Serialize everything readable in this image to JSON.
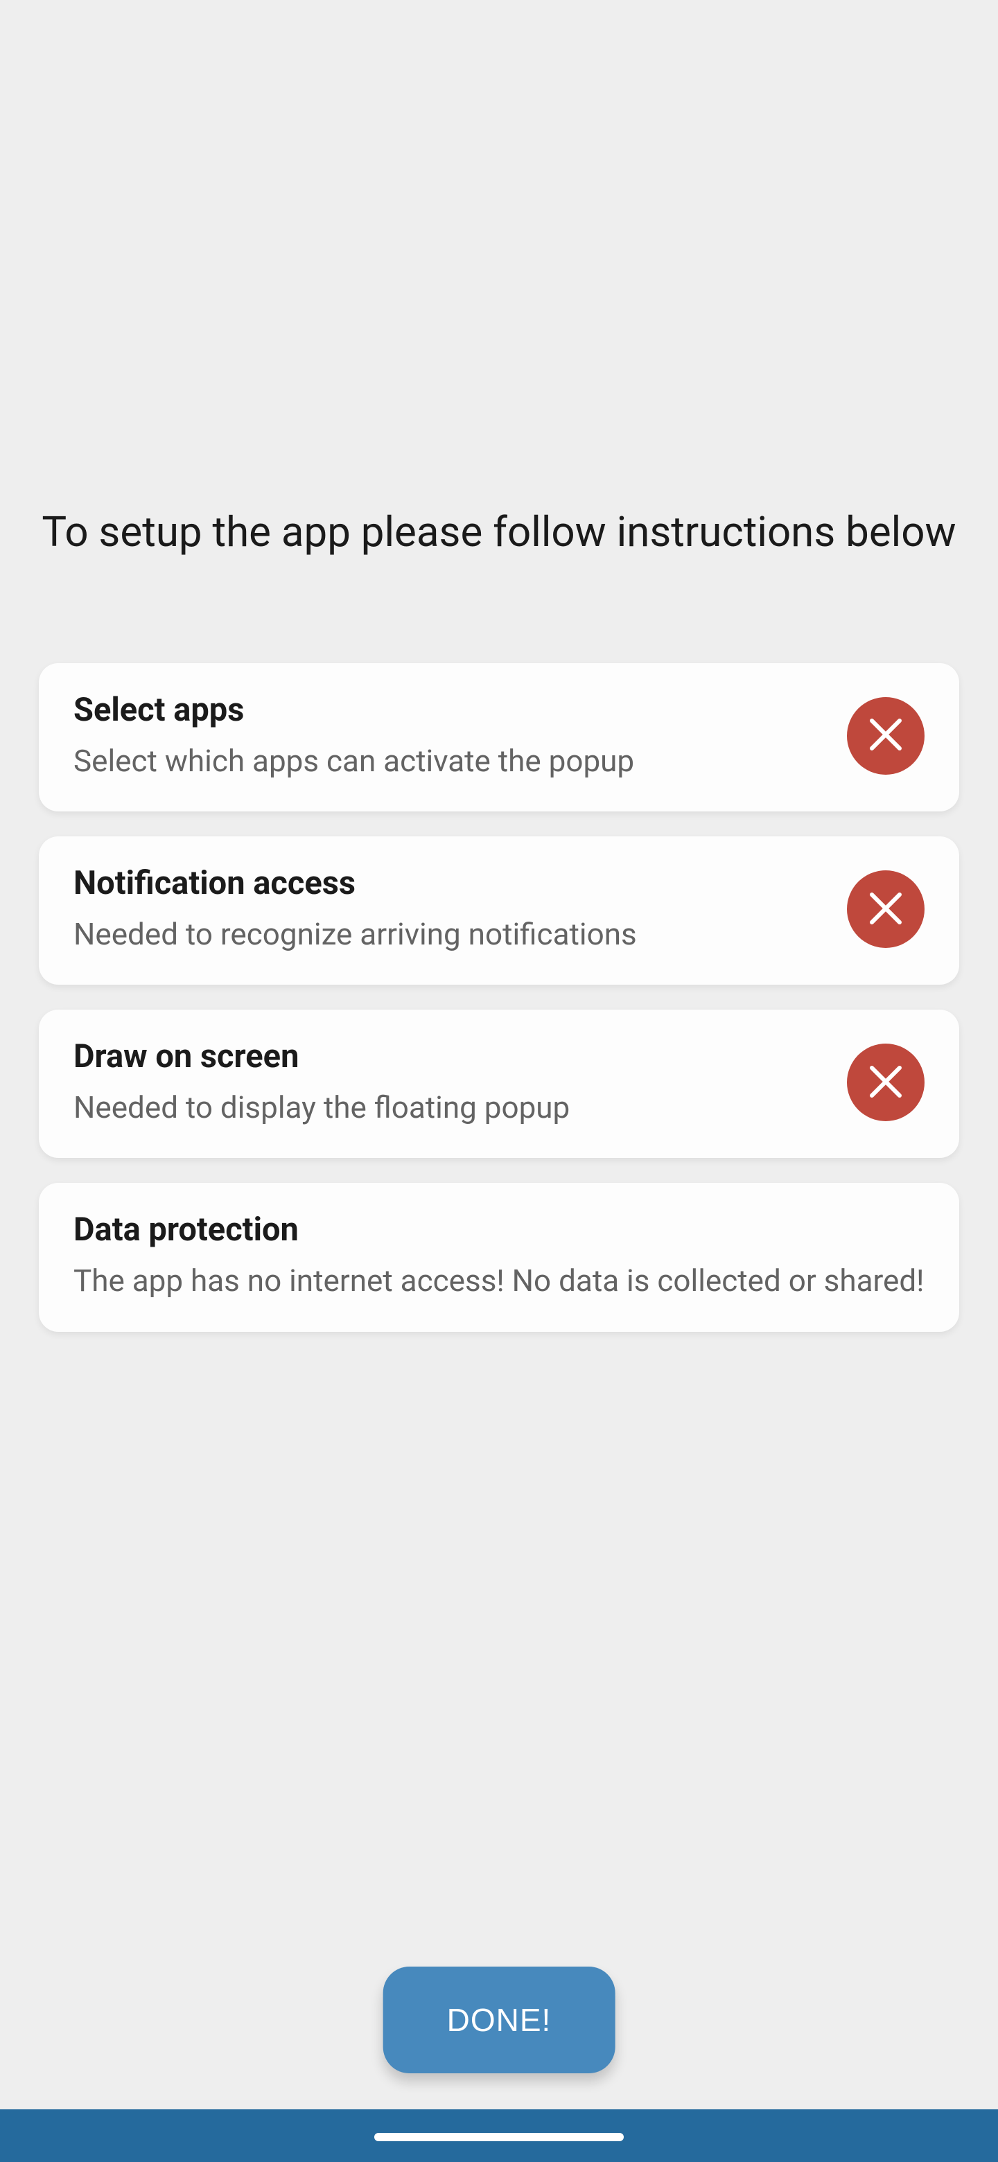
{
  "heading": "To setup the app please follow instructions below",
  "cards": [
    {
      "title": "Select apps",
      "sub": "Select which apps can activate the popup",
      "status": "error"
    },
    {
      "title": "Notification access",
      "sub": "Needed to recognize arriving notifications",
      "status": "error"
    },
    {
      "title": "Draw on screen",
      "sub": "Needed to display the floating popup",
      "status": "error"
    },
    {
      "title": "Data protection",
      "sub": "The app has no internet access! No data is collected or shared!",
      "status": "none"
    }
  ],
  "done_label": "DONE!",
  "colors": {
    "error": "#bf483c",
    "accent": "#4789bd",
    "nav": "#256a9d"
  }
}
